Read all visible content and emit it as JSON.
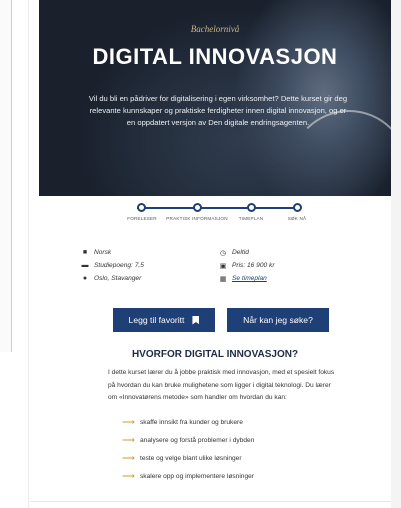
{
  "hero": {
    "kicker": "Bachelornivå",
    "title": "DIGITAL INNOVASJON",
    "description": "Vil du bli en pådriver for digitalisering i egen virksomhet? Dette kurset gir deg relevante kunnskaper og praktiske ferdigheter innen digital innovasjon, og er en oppdatert versjon av Den digitale endringsagenten."
  },
  "steps": [
    "FORELESER",
    "PRAKTISK INFORMASJON",
    "TIMEPLAN",
    "SØK NÅ"
  ],
  "facts": {
    "language": "Norsk",
    "credits": "Studiepoeng: 7,5",
    "location": "Oslo, Stavanger",
    "mode": "Deltid",
    "price": "Pris: 16 900 kr",
    "dates_link": "Se timeplan"
  },
  "buttons": {
    "favorite": "Legg til favoritt",
    "apply_when": "Når kan jeg søke?"
  },
  "why": {
    "title": "HVORFOR DIGITAL INNOVASJON?",
    "body": "I dette kurset lærer du å jobbe praktisk med innovasjon, med et spesielt fokus på hvordan du kan bruke mulighetene som ligger i digital teknologi. Du lærer om «Innovatørens metode» som handler om hvordan du kan:",
    "items": [
      "skaffe innsikt fra kunder og brukere",
      "analysere og forstå problemer i dybden",
      "teste og velge blant ulike løsninger",
      "skalere opp og implementere løsninger"
    ]
  },
  "colors": {
    "brand_blue": "#1f3f77",
    "accent_orange": "#d79a2b"
  }
}
